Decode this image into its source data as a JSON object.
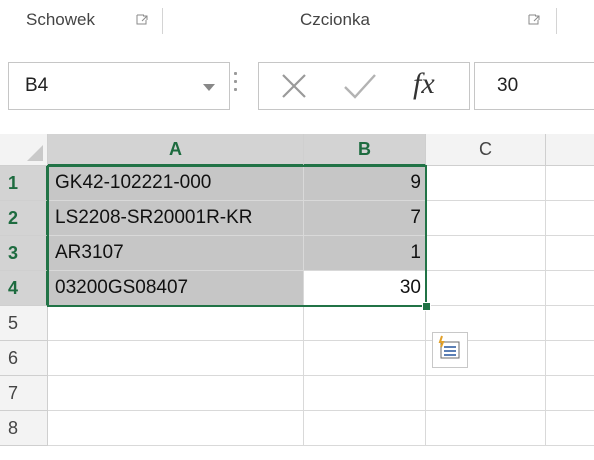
{
  "ribbon": {
    "groups": [
      {
        "label": "Schowek",
        "launcher_icon": "dialog-launcher-icon"
      },
      {
        "label": "Czcionka",
        "launcher_icon": "dialog-launcher-icon"
      }
    ]
  },
  "formula_bar": {
    "name_box": "B4",
    "cancel_icon": "close-icon",
    "enter_icon": "checkmark-icon",
    "insert_function_label": "fx",
    "content": "30"
  },
  "sheet": {
    "columns": [
      "A",
      "B",
      "C"
    ],
    "rows": [
      {
        "num": "1",
        "a": "GK42-102221-000",
        "b": "9"
      },
      {
        "num": "2",
        "a": "LS2208-SR20001R-KR",
        "b": "7"
      },
      {
        "num": "3",
        "a": "AR3107",
        "b": "1"
      },
      {
        "num": "4",
        "a": "03200GS08407",
        "b": "30"
      },
      {
        "num": "5",
        "a": "",
        "b": ""
      },
      {
        "num": "6",
        "a": "",
        "b": ""
      },
      {
        "num": "7",
        "a": "",
        "b": ""
      },
      {
        "num": "8",
        "a": "",
        "b": ""
      }
    ],
    "selection": "A1:B4",
    "active_cell": "B4",
    "quick_analysis_icon": "quick-analysis-icon"
  },
  "colors": {
    "selection_border": "#217346",
    "selected_header_bg": "#d3d3d3",
    "selected_cells_bg": "#c6c6c6"
  }
}
